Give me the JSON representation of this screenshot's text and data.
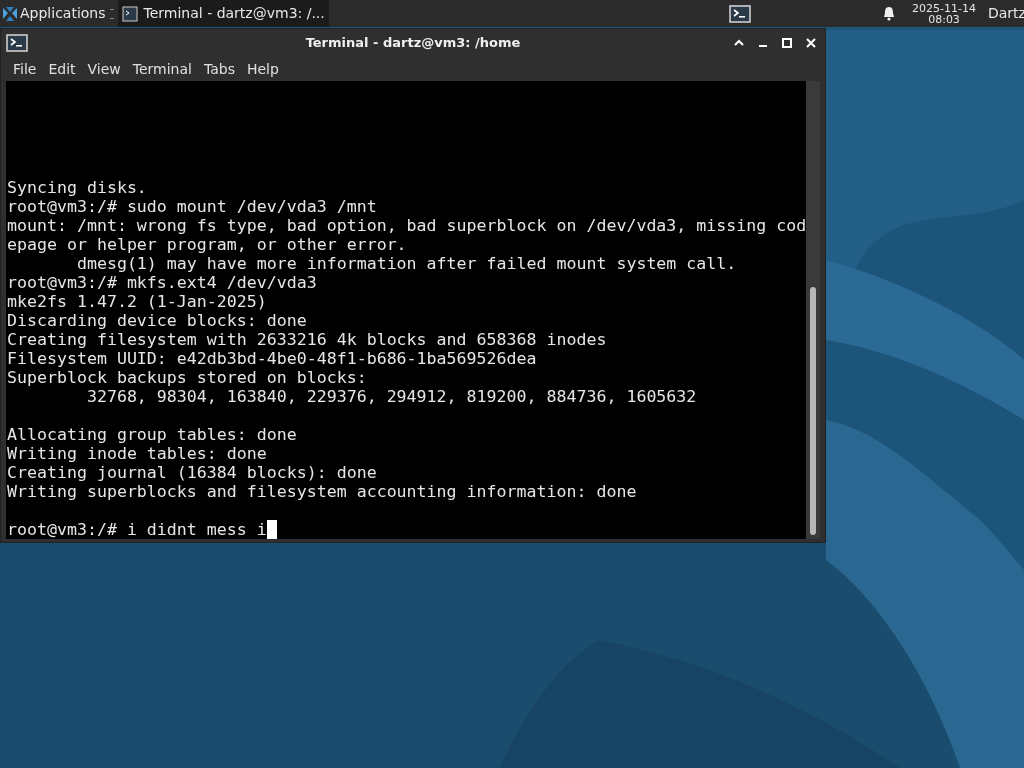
{
  "panel": {
    "apps_label": "Applications",
    "tasks": [
      {
        "label": "Terminal - dartz@vm3: /...",
        "selected": true
      }
    ],
    "clock_date": "2025-11-14",
    "clock_time": "08:03",
    "user": "Dartz"
  },
  "window": {
    "title": "Terminal - dartz@vm3: /home",
    "menu": [
      "File",
      "Edit",
      "View",
      "Terminal",
      "Tabs",
      "Help"
    ]
  },
  "terminal": {
    "lines": [
      {
        "kind": "text",
        "text": "Syncing disks."
      },
      {
        "kind": "text",
        "text": "root@vm3:/# sudo mount /dev/vda3 /mnt"
      },
      {
        "kind": "text",
        "text": "mount: /mnt: wrong fs type, bad option, bad superblock on /dev/vda3, missing cod"
      },
      {
        "kind": "text",
        "text": "epage or helper program, or other error."
      },
      {
        "kind": "text",
        "text": "       dmesg(1) may have more information after failed mount system call."
      },
      {
        "kind": "text",
        "text": "root@vm3:/# mkfs.ext4 /dev/vda3"
      },
      {
        "kind": "text",
        "text": "mke2fs 1.47.2 (1-Jan-2025)"
      },
      {
        "kind": "text",
        "text": "Discarding device blocks: done"
      },
      {
        "kind": "text",
        "text": "Creating filesystem with 2633216 4k blocks and 658368 inodes"
      },
      {
        "kind": "text",
        "text": "Filesystem UUID: e42db3bd-4be0-48f1-b686-1ba569526dea"
      },
      {
        "kind": "text",
        "text": "Superblock backups stored on blocks:"
      },
      {
        "kind": "text",
        "text": "        32768, 98304, 163840, 229376, 294912, 819200, 884736, 1605632"
      },
      {
        "kind": "blank"
      },
      {
        "kind": "text",
        "text": "Allocating group tables: done"
      },
      {
        "kind": "text",
        "text": "Writing inode tables: done"
      },
      {
        "kind": "text",
        "text": "Creating journal (16384 blocks): done"
      },
      {
        "kind": "text",
        "text": "Writing superblocks and filesystem accounting information: done"
      },
      {
        "kind": "blank"
      },
      {
        "kind": "input",
        "text": "root@vm3:/# i didnt mess i"
      }
    ]
  }
}
